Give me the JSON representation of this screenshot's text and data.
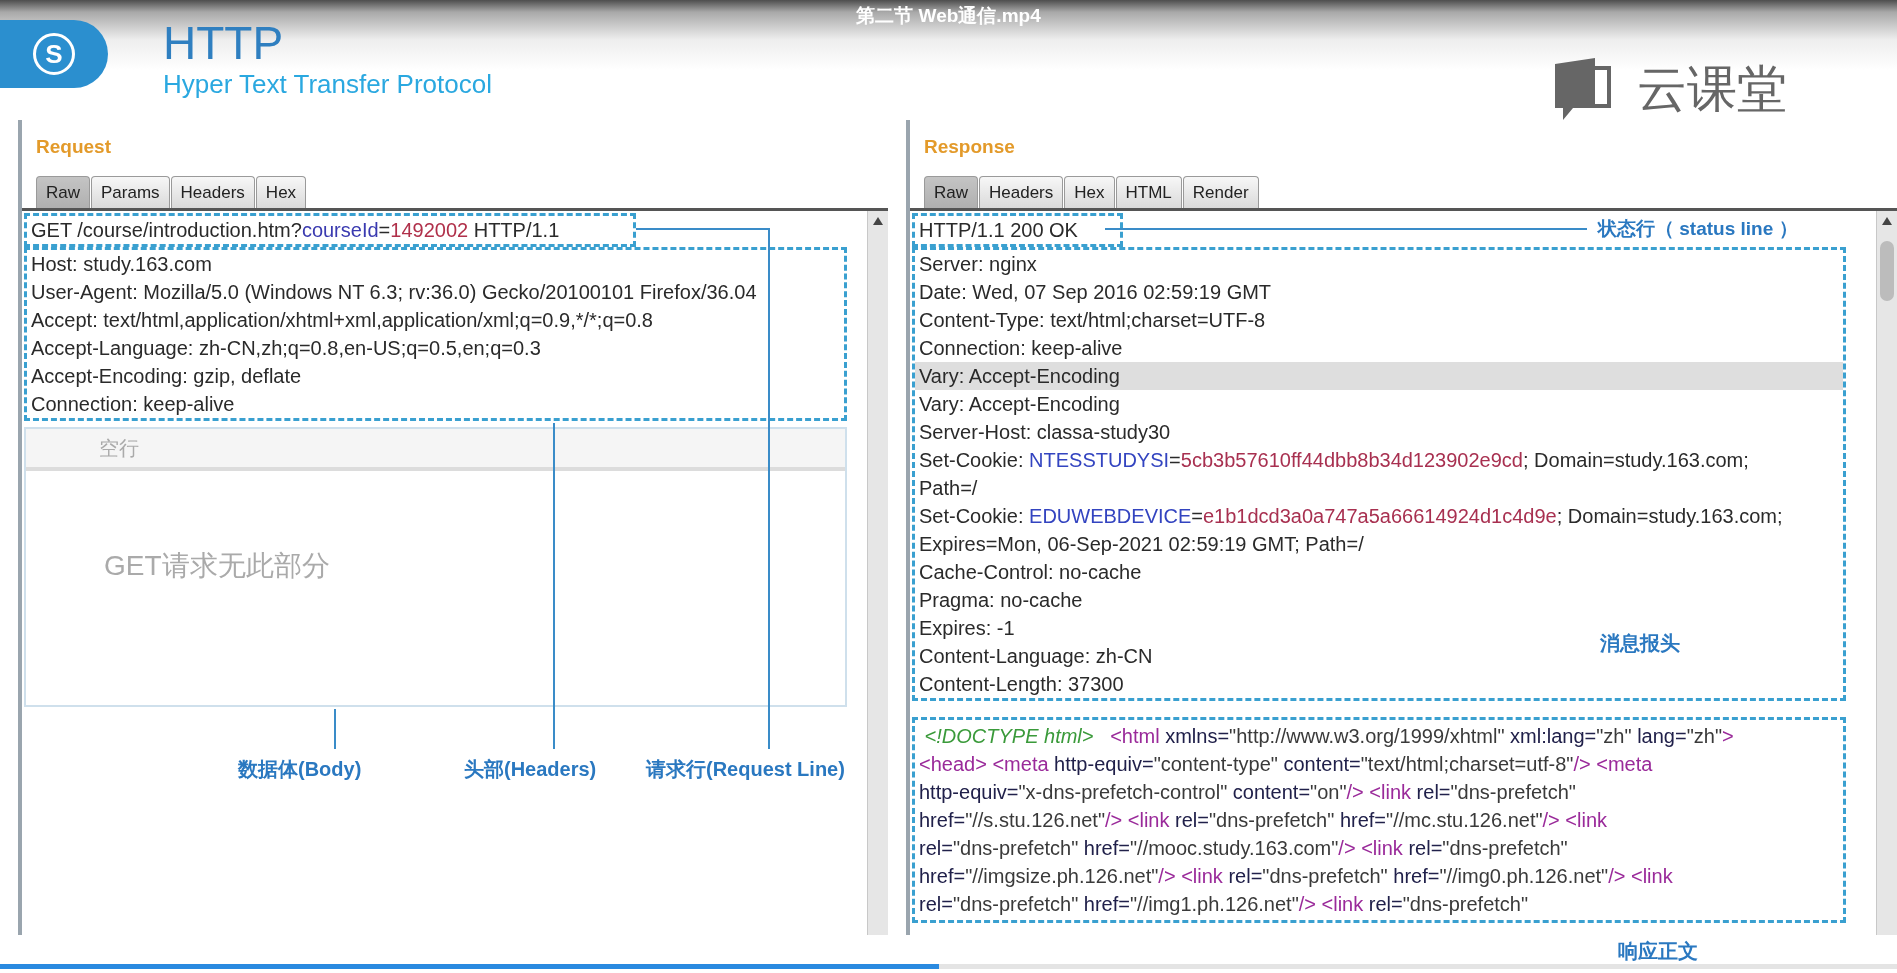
{
  "video": {
    "title": "第二节 Web通信.mp4",
    "progress": {
      "level": 0.495
    }
  },
  "header": {
    "logo_mark": "S",
    "title": "HTTP",
    "subtitle": "Hyper Text Transfer Protocol",
    "brand": "云课堂"
  },
  "request": {
    "label": "Request",
    "tabs": [
      {
        "label": "Raw",
        "selected": true
      },
      {
        "label": "Params",
        "selected": false
      },
      {
        "label": "Headers",
        "selected": false
      },
      {
        "label": "Hex",
        "selected": false
      }
    ],
    "request_line": {
      "segments": [
        {
          "kind": "plain",
          "text": "GET /course/introduction.htm?"
        },
        {
          "kind": "param",
          "text": "courseId"
        },
        {
          "kind": "plain",
          "text": "="
        },
        {
          "kind": "value",
          "text": "1492002"
        },
        {
          "kind": "plain",
          "text": " HTTP/1.1"
        }
      ]
    },
    "headers": [
      "Host: study.163.com",
      "User-Agent: Mozilla/5.0 (Windows NT 6.3; rv:36.0) Gecko/20100101 Firefox/36.04",
      "Accept: text/html,application/xhtml+xml,application/xml;q=0.9,*/*;q=0.8",
      "Accept-Language: zh-CN,zh;q=0.8,en-US;q=0.5,en;q=0.3",
      "Accept-Encoding: gzip, deflate",
      "Connection: keep-alive"
    ],
    "blank_line_label": "空行",
    "body_note": "GET请求无此部分",
    "annotations": {
      "body": "数据体(Body)",
      "headers": "头部(Headers)",
      "request_line": "请求行(Request Line)"
    }
  },
  "response": {
    "label": "Response",
    "tabs": [
      {
        "label": "Raw",
        "selected": true
      },
      {
        "label": "Headers",
        "selected": false
      },
      {
        "label": "Hex",
        "selected": false
      },
      {
        "label": "HTML",
        "selected": false
      },
      {
        "label": "Render",
        "selected": false
      }
    ],
    "status_line": "HTTP/1.1 200 OK",
    "status_annotation": "状态行（ status line ）",
    "headers": [
      {
        "selected": false,
        "text": "Server: nginx"
      },
      {
        "selected": false,
        "text": "Date: Wed, 07 Sep 2016 02:59:19 GMT"
      },
      {
        "selected": false,
        "text": "Content-Type: text/html;charset=UTF-8"
      },
      {
        "selected": false,
        "text": "Connection: keep-alive"
      },
      {
        "selected": true,
        "text": "Vary: Accept-Encoding"
      },
      {
        "selected": false,
        "text": "Vary: Accept-Encoding"
      },
      {
        "selected": false,
        "text": "Server-Host: classa-study30"
      },
      {
        "selected": false,
        "segments": [
          {
            "kind": "plain",
            "text": "Set-Cookie: "
          },
          {
            "kind": "cookie",
            "text": "NTESSTUDYSI"
          },
          {
            "kind": "plain",
            "text": "="
          },
          {
            "kind": "cookieval",
            "text": "5cb3b57610ff44dbb8b34d123902e9cd"
          },
          {
            "kind": "plain",
            "text": "; Domain=study.163.com;"
          }
        ]
      },
      {
        "selected": false,
        "text": "Path=/"
      },
      {
        "selected": false,
        "segments": [
          {
            "kind": "plain",
            "text": "Set-Cookie: "
          },
          {
            "kind": "cookie",
            "text": "EDUWEBDEVICE"
          },
          {
            "kind": "plain",
            "text": "="
          },
          {
            "kind": "cookieval",
            "text": "e1b1dcd3a0a747a5a66614924d1c4d9e"
          },
          {
            "kind": "plain",
            "text": "; Domain=study.163.com;"
          }
        ]
      },
      {
        "selected": false,
        "text": "Expires=Mon, 06-Sep-2021 02:59:19 GMT; Path=/"
      },
      {
        "selected": false,
        "text": "Cache-Control: no-cache"
      },
      {
        "selected": false,
        "text": "Pragma: no-cache"
      },
      {
        "selected": false,
        "text": "Expires: -1"
      },
      {
        "selected": false,
        "text": "Content-Language: zh-CN"
      },
      {
        "selected": false,
        "text": "Content-Length: 37300"
      }
    ],
    "headers_annotation": "消息报头",
    "body": [
      {
        "segments": [
          {
            "kind": "doctype",
            "text": " <!DOCTYPE html>"
          },
          {
            "kind": "tag",
            "text": "   <html"
          },
          {
            "kind": "attr",
            "text": " xmlns="
          },
          {
            "kind": "attrval",
            "text": "\"http://www.w3.org/1999/xhtml\""
          },
          {
            "kind": "attr",
            "text": " xml:lang="
          },
          {
            "kind": "attrval",
            "text": "\"zh\""
          },
          {
            "kind": "attr",
            "text": " lang="
          },
          {
            "kind": "attrval",
            "text": "\"zh\""
          },
          {
            "kind": "tag",
            "text": ">"
          }
        ]
      },
      {
        "segments": [
          {
            "kind": "tag",
            "text": "<head>"
          },
          {
            "kind": "tag",
            "text": " <meta"
          },
          {
            "kind": "attr",
            "text": " http-equiv="
          },
          {
            "kind": "attrval",
            "text": "\"content-type\""
          },
          {
            "kind": "attr",
            "text": " content="
          },
          {
            "kind": "attrval",
            "text": "\"text/html;charset=utf-8\""
          },
          {
            "kind": "tag",
            "text": "/>"
          },
          {
            "kind": "tag",
            "text": " <meta"
          }
        ]
      },
      {
        "segments": [
          {
            "kind": "attr",
            "text": "http-equiv="
          },
          {
            "kind": "attrval",
            "text": "\"x-dns-prefetch-control\""
          },
          {
            "kind": "attr",
            "text": " content="
          },
          {
            "kind": "attrval",
            "text": "\"on\""
          },
          {
            "kind": "tag",
            "text": "/>"
          },
          {
            "kind": "tag",
            "text": " <link"
          },
          {
            "kind": "attr",
            "text": " rel="
          },
          {
            "kind": "attrval",
            "text": "\"dns-prefetch\""
          }
        ]
      },
      {
        "segments": [
          {
            "kind": "attr",
            "text": "href="
          },
          {
            "kind": "attrval",
            "text": "\"//s.stu.126.net\""
          },
          {
            "kind": "tag",
            "text": "/>"
          },
          {
            "kind": "tag",
            "text": " <link"
          },
          {
            "kind": "attr",
            "text": " rel="
          },
          {
            "kind": "attrval",
            "text": "\"dns-prefetch\""
          },
          {
            "kind": "attr",
            "text": " href="
          },
          {
            "kind": "attrval",
            "text": "\"//mc.stu.126.net\""
          },
          {
            "kind": "tag",
            "text": "/>"
          },
          {
            "kind": "tag",
            "text": " <link"
          }
        ]
      },
      {
        "segments": [
          {
            "kind": "attr",
            "text": "rel="
          },
          {
            "kind": "attrval",
            "text": "\"dns-prefetch\""
          },
          {
            "kind": "attr",
            "text": " href="
          },
          {
            "kind": "attrval",
            "text": "\"//mooc.study.163.com\""
          },
          {
            "kind": "tag",
            "text": "/>"
          },
          {
            "kind": "tag",
            "text": " <link"
          },
          {
            "kind": "attr",
            "text": " rel="
          },
          {
            "kind": "attrval",
            "text": "\"dns-prefetch\""
          }
        ]
      },
      {
        "segments": [
          {
            "kind": "attr",
            "text": "href="
          },
          {
            "kind": "attrval",
            "text": "\"//imgsize.ph.126.net\""
          },
          {
            "kind": "tag",
            "text": "/>"
          },
          {
            "kind": "tag",
            "text": " <link"
          },
          {
            "kind": "attr",
            "text": " rel="
          },
          {
            "kind": "attrval",
            "text": "\"dns-prefetch\""
          },
          {
            "kind": "attr",
            "text": " href="
          },
          {
            "kind": "attrval",
            "text": "\"//img0.ph.126.net\""
          },
          {
            "kind": "tag",
            "text": "/>"
          },
          {
            "kind": "tag",
            "text": " <link"
          }
        ]
      },
      {
        "segments": [
          {
            "kind": "attr",
            "text": "rel="
          },
          {
            "kind": "attrval",
            "text": "\"dns-prefetch\""
          },
          {
            "kind": "attr",
            "text": " href="
          },
          {
            "kind": "attrval",
            "text": "\"//img1.ph.126.net\""
          },
          {
            "kind": "tag",
            "text": "/>"
          },
          {
            "kind": "tag",
            "text": " <link"
          },
          {
            "kind": "attr",
            "text": " rel="
          },
          {
            "kind": "attrval",
            "text": "\"dns-prefetch\""
          }
        ]
      }
    ],
    "body_annotation": "响应正文"
  }
}
